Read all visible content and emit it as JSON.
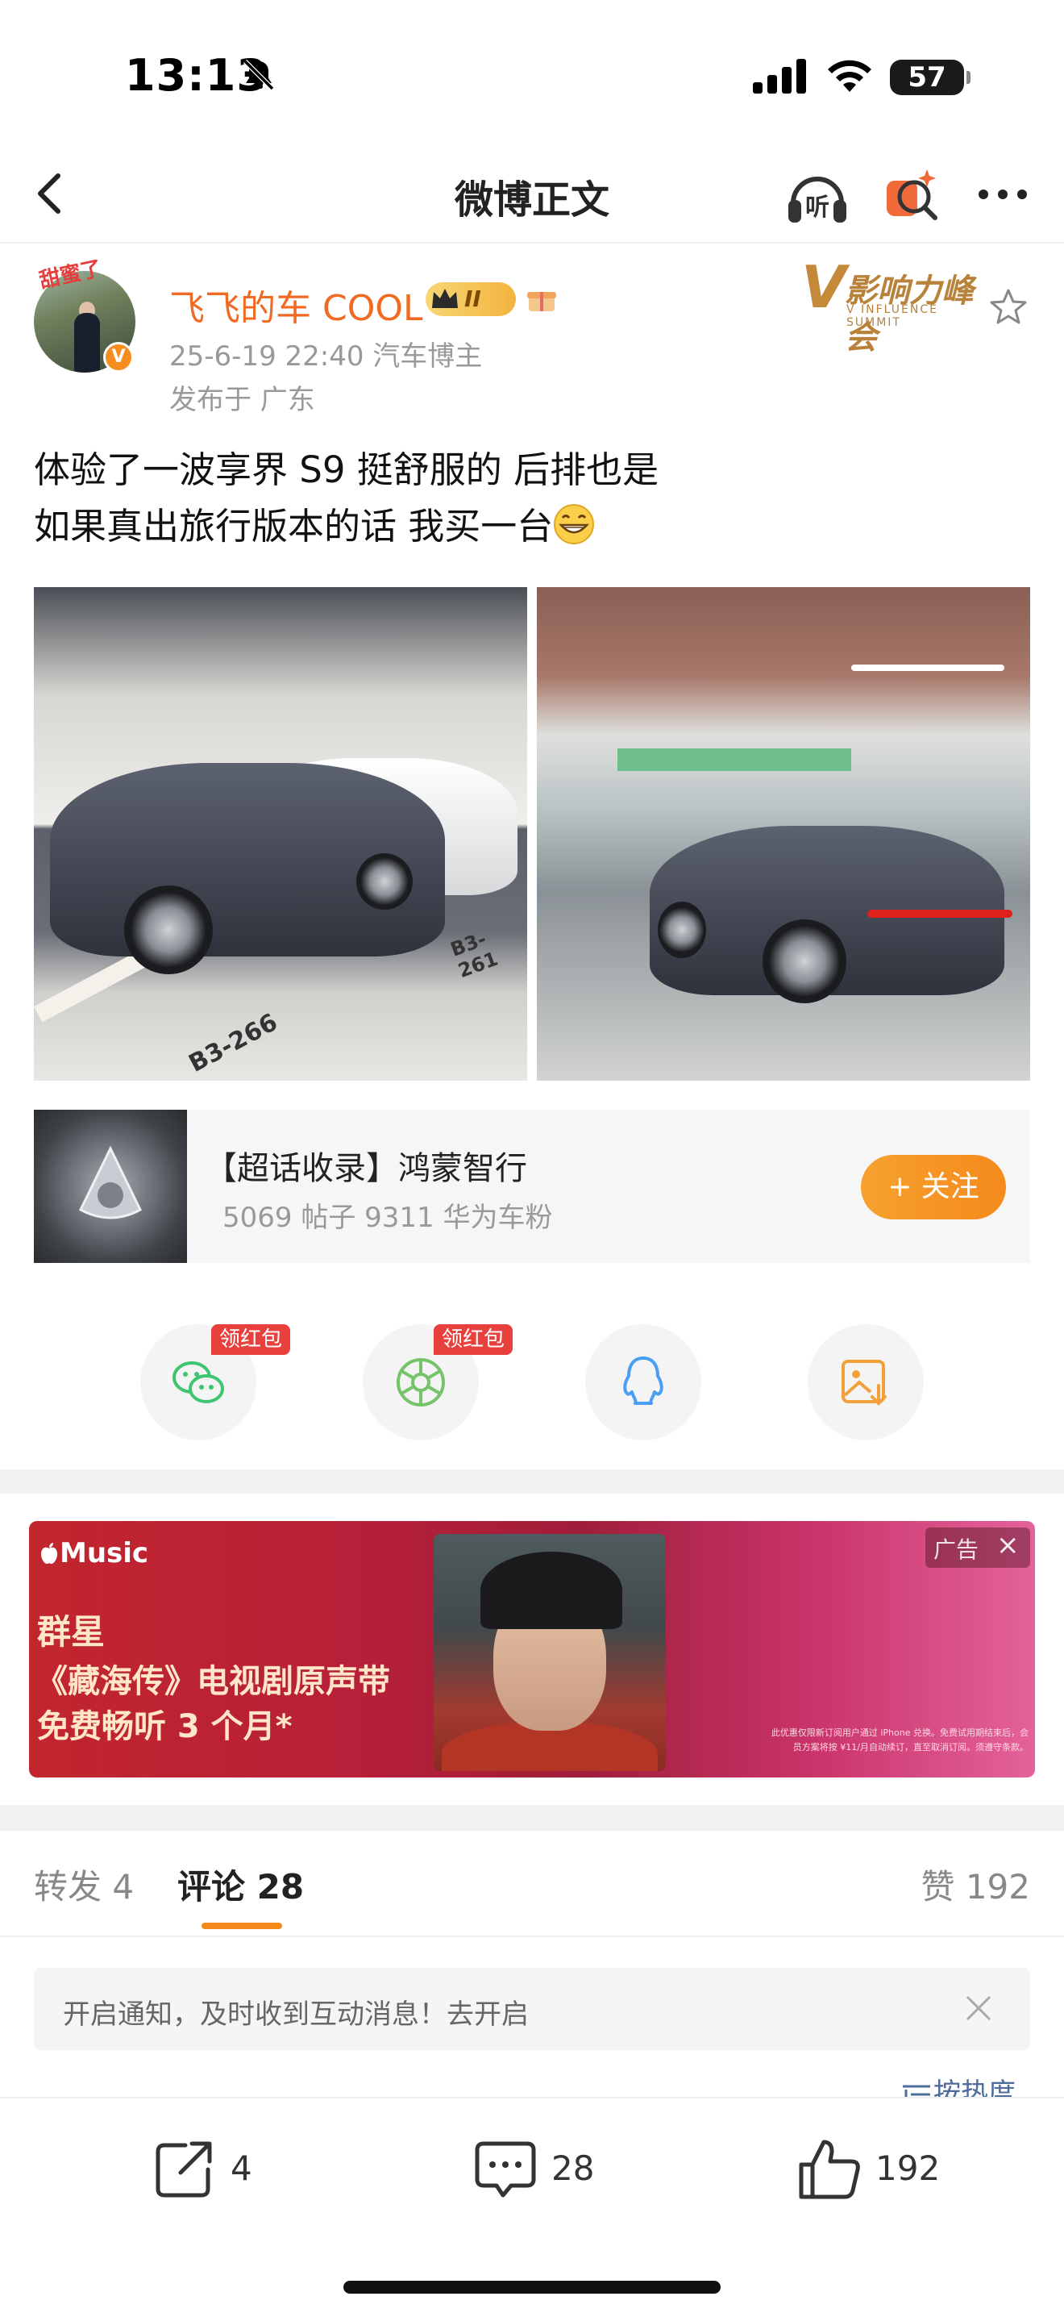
{
  "status_bar": {
    "time": "13:13",
    "battery": "57"
  },
  "nav": {
    "title": "微博正文",
    "listen_label": "听"
  },
  "post": {
    "avatar_tag": "甜蜜了",
    "author": "飞飞的车 COOL",
    "level": "II",
    "meta": "25-6-19 22:40  汽车博主",
    "location": "发布于 广东",
    "summit": {
      "mark": "V",
      "title": "影响力峰会",
      "subtitle": "V INFLUENCE SUMMIT"
    },
    "text_line1": "体验了一波享界 S9 挺舒服的 后排也是",
    "text_line2": "如果真出旅行版本的话 我买一台",
    "photo_labels": [
      "B3-266",
      "B3-261"
    ]
  },
  "topic": {
    "title": "【超话收录】鸿蒙智行",
    "stats": "5069 帖子 9311 华为车粉",
    "follow_label": "+ 关注"
  },
  "share": {
    "redpack_label": "领红包"
  },
  "ad": {
    "brand": "Music",
    "line1": "群星",
    "line2": "《藏海传》电视剧原声带",
    "line3": "免费畅听 3 个月*",
    "fine_print": "此优惠仅限新订阅用户通过 iPhone 兑换。免费试用期结束后，会员方案将按 ¥11/月自动续订，直至取消订阅。须遵守条款。",
    "tag_label": "广告",
    "close_label": "×"
  },
  "tabs": {
    "repost": "转发 4",
    "comment": "评论 28",
    "like": "赞 192"
  },
  "notify": {
    "text": "开启通知，及时收到互动消息！去开启"
  },
  "sort_label": "按热度",
  "bottom_bar": {
    "repost_count": "4",
    "comment_count": "28",
    "like_count": "192"
  },
  "colors": {
    "brand_orange": "#f48a1c",
    "username_orange": "#f26922",
    "redpack_red": "#e8413d",
    "wechat_green": "#3fc470",
    "moments_green": "#76c46a",
    "qq_blue": "#4a9ff5",
    "save_orange": "#f2a13a"
  },
  "icons": [
    "back-icon",
    "headphones-icon",
    "ai-search-icon",
    "more-icon",
    "star-icon",
    "wechat-icon",
    "moments-icon",
    "qq-icon",
    "save-image-icon",
    "close-icon",
    "sort-icon",
    "repost-icon",
    "comment-icon",
    "like-icon"
  ]
}
